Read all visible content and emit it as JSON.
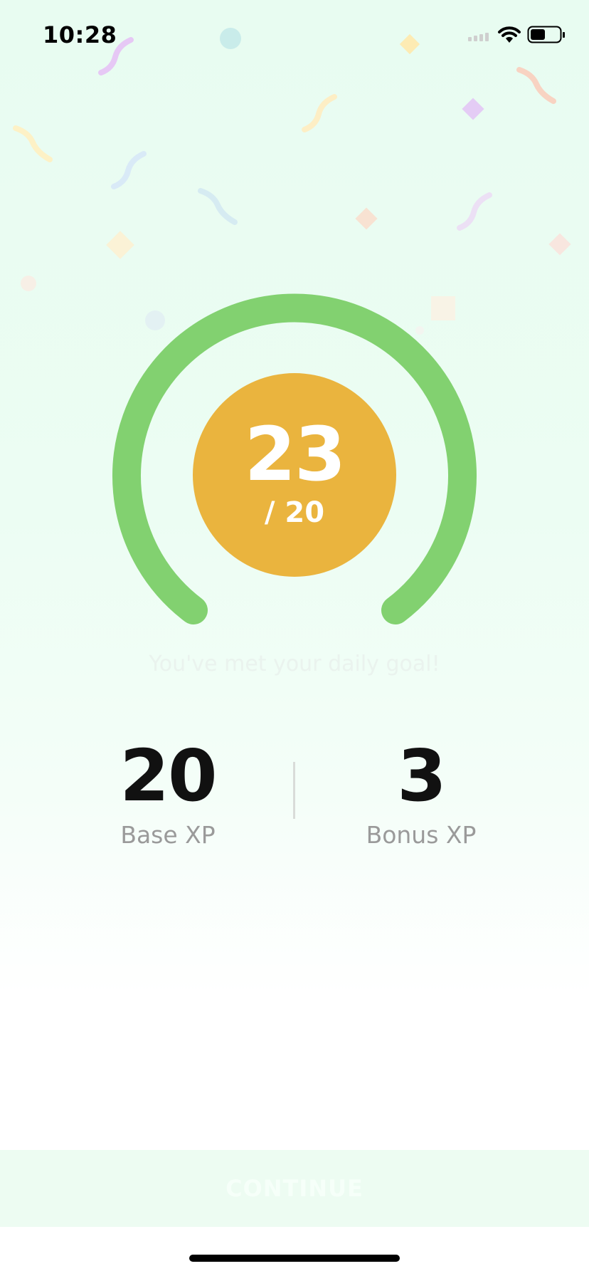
{
  "status_bar": {
    "time": "10:28",
    "icons": [
      "signal-icon",
      "wifi-icon",
      "battery-icon"
    ]
  },
  "progress": {
    "xp_earned": "23",
    "xp_goal_label": "/ 20",
    "completion_fraction": 1.0,
    "ring_color": "#82d170",
    "circle_color": "#eab43e"
  },
  "goal_message": "You've met your daily goal!",
  "stats": {
    "base": {
      "value": "20",
      "label": "Base XP"
    },
    "bonus": {
      "value": "3",
      "label": "Bonus XP"
    }
  },
  "continue_button": {
    "label": "CONTINUE"
  },
  "colors": {
    "background_top": "#e8fcf1",
    "accent_green": "#82d170",
    "accent_gold": "#eab43e"
  }
}
